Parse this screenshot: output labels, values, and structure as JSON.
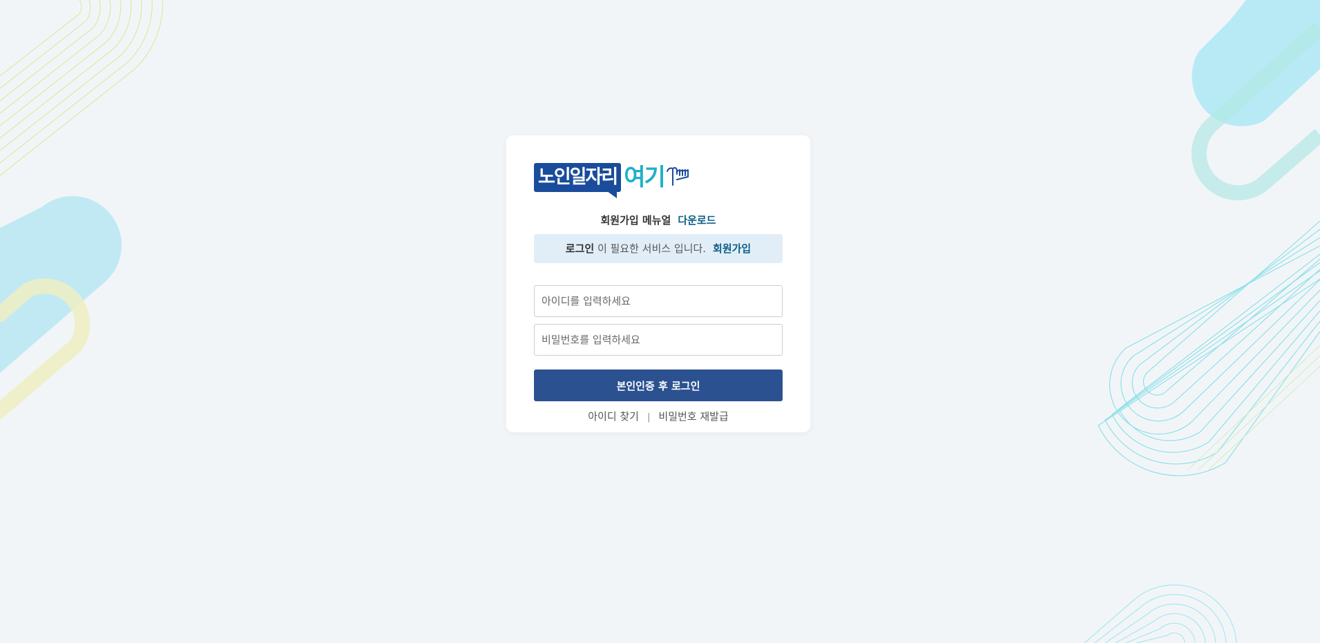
{
  "logo": {
    "part1": "노인일자리",
    "part2": "여기",
    "brand_color": "#1a4c9c",
    "accent_color": "#1fb0c8"
  },
  "manual": {
    "label": "회원가입 메뉴얼",
    "download_link": "다운로드"
  },
  "notice": {
    "strong": "로그인",
    "text": " 이 필요한 서비스 입니다.",
    "signup_link": "회원가입"
  },
  "form": {
    "id_placeholder": "아이디를 입력하세요",
    "id_value": "",
    "pw_placeholder": "비밀번호를 입력하세요",
    "pw_value": "",
    "login_button": "본인인증 후 로그인",
    "button_color": "#2b5190"
  },
  "links": {
    "find_id": "아이디 찾기",
    "separator": "|",
    "reset_pw": "비밀번호 재발급"
  }
}
